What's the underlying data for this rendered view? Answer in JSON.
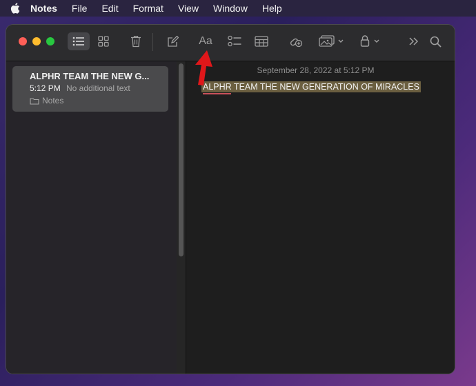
{
  "menubar": {
    "apple_icon": "apple-logo-icon",
    "items": [
      "Notes",
      "File",
      "Edit",
      "Format",
      "View",
      "Window",
      "Help"
    ]
  },
  "toolbar": {
    "buttons": [
      "list-view-icon",
      "gallery-view-icon",
      "trash-icon",
      "compose-icon",
      "text-format-icon",
      "checklist-icon",
      "table-icon",
      "link-icon",
      "media-icon",
      "lock-icon",
      "more-icon",
      "search-icon"
    ],
    "format_label": "Aa"
  },
  "sidebar": {
    "notes": [
      {
        "title": "ALPHR TEAM THE NEW G...",
        "time": "5:12 PM",
        "preview": "No additional text",
        "folder": "Notes"
      }
    ]
  },
  "editor": {
    "date": "September 28, 2022 at 5:12 PM",
    "body": "ALPHR TEAM THE NEW GENERATION OF MIRACLES"
  },
  "colors": {
    "accent_arrow": "#e0171a",
    "highlight": "#6b5f40",
    "traffic_red": "#ff5f57",
    "traffic_yellow": "#febc2e",
    "traffic_green": "#28c840"
  }
}
